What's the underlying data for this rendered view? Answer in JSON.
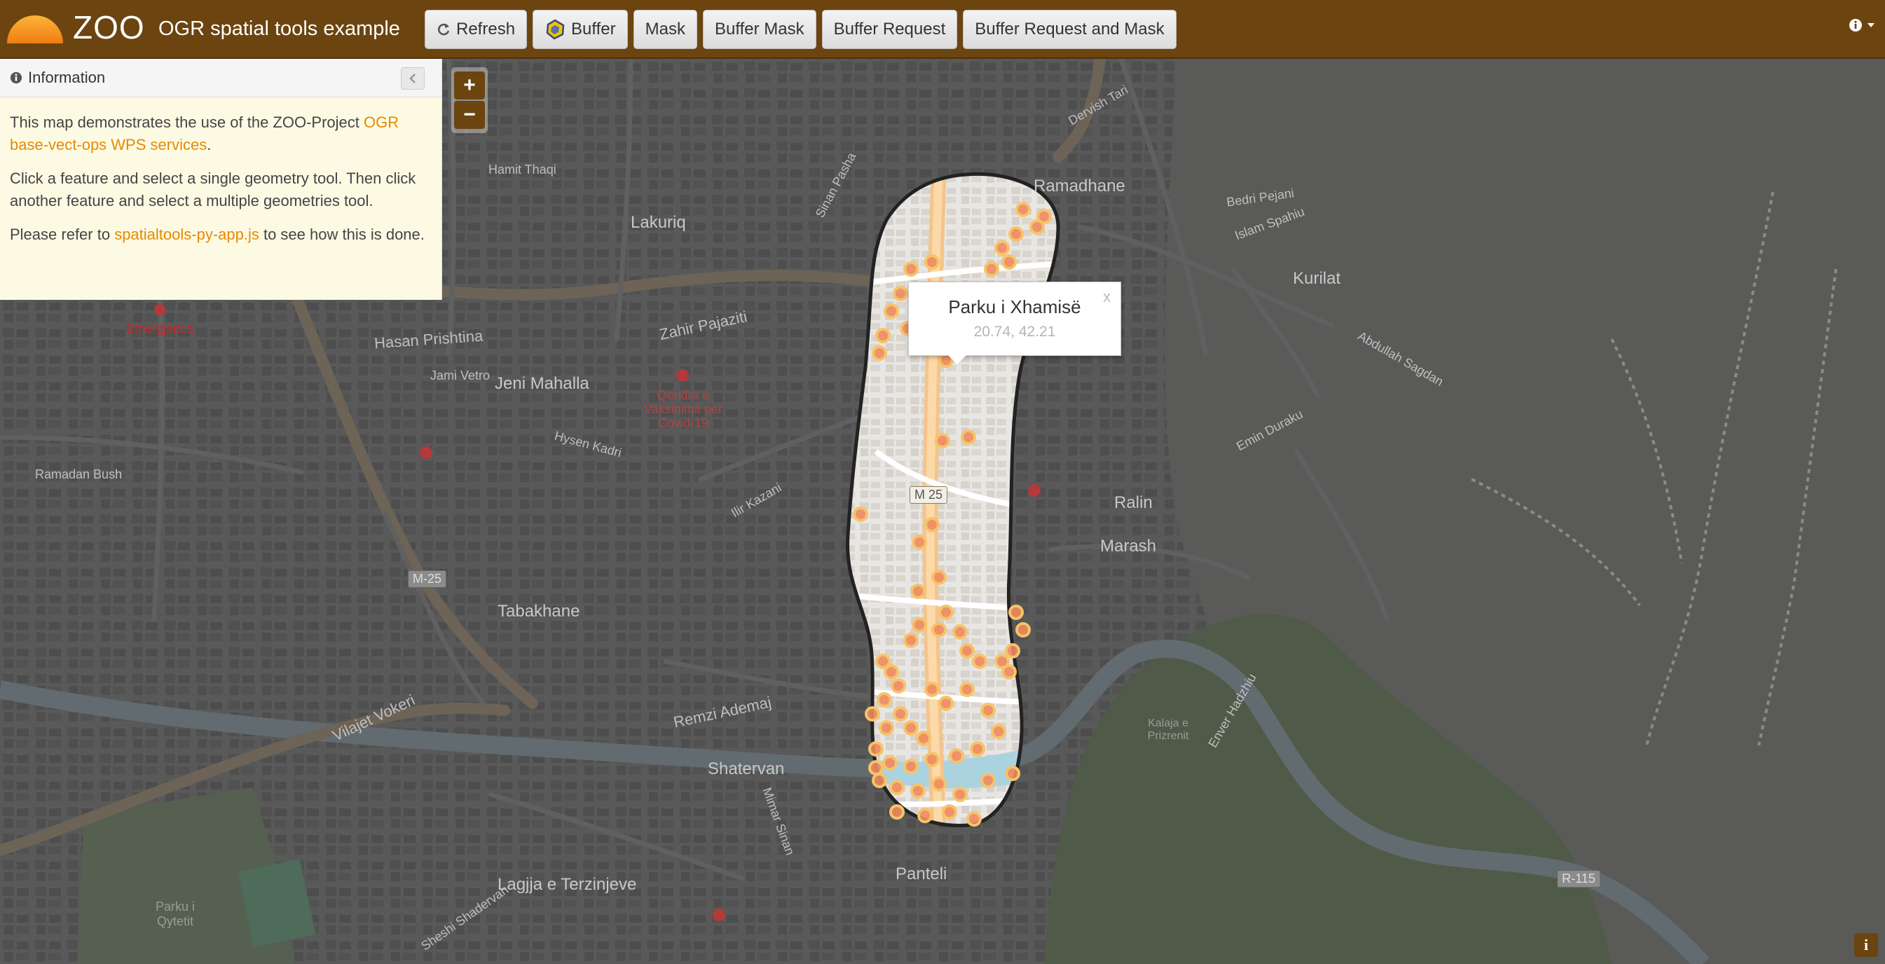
{
  "header": {
    "brand_name": "ZOO",
    "app_title": "OGR spatial tools example",
    "buttons": [
      {
        "label": "Refresh",
        "icon": "refresh-icon"
      },
      {
        "label": "Buffer",
        "icon": "buffer-icon"
      },
      {
        "label": "Mask"
      },
      {
        "label": "Buffer Mask"
      },
      {
        "label": "Buffer Request"
      },
      {
        "label": "Buffer Request and Mask"
      }
    ],
    "info_menu_icon": "info-icon",
    "colors": {
      "brand": "#6b4410",
      "accent": "#e68a00"
    }
  },
  "zoom": {
    "in": "+",
    "out": "−"
  },
  "panel": {
    "title": "Information",
    "collapse_icon": "chevron-left-icon",
    "p1_text": "This map demonstrates the use of the ZOO-Project ",
    "p1_link": "OGR base-vect-ops WPS services",
    "p1_end": ".",
    "p2_text": "Click a feature and select a single geometry tool. Then click another feature and select a multiple geometries tool.",
    "p3_text": "Please refer to ",
    "p3_link": "spatialtools-py-app.js",
    "p3_end": " to see how this is done."
  },
  "popup": {
    "title": "Parku i Xhamisë",
    "coords": "20.74, 42.21",
    "close": "x"
  },
  "attribution": "i",
  "map": {
    "neighborhoods": [
      "Lakuriq",
      "Jeni Mahalla",
      "Tabakhane",
      "Shatervan",
      "Lagjja e Terzinjeve",
      "Panteli",
      "Ramadhane",
      "Kurilat",
      "Ralin",
      "Marash"
    ],
    "streets": [
      "Hasan Prishtina",
      "Zahir Pajaziti",
      "Remzi Ademaj",
      "Vilajet Vokeri",
      "Ramadan Bush",
      "Jami Vetro",
      "Bedri Pejani",
      "Islam Spahiu",
      "Abdullah Sagdan",
      "Emin Duraku",
      "Hysen Kadri",
      "Hamit Thaqi",
      "Ilir Kazani",
      "Enver Hadzhiu",
      "Sheshi Shadervan",
      "Mimar Sinan",
      "Sinan Pasha",
      "Dervish Tari"
    ],
    "roads": [
      "M 25",
      "M-25",
      "R-115"
    ],
    "pois": [
      "Emergjenca",
      "Qendra e Vaksinimit per Covid-19",
      "Kalaja e Prizrenit"
    ],
    "park": "Parku i Qytetit"
  }
}
